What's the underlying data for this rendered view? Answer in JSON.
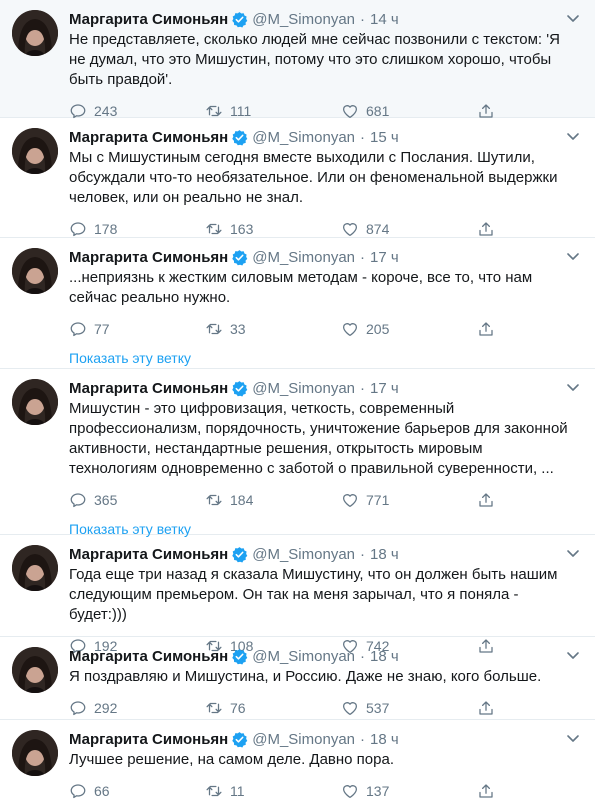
{
  "colors": {
    "accent": "#1da1f2",
    "muted": "#657786",
    "text": "#14171a",
    "highlight_bg": "#f5f8fa",
    "divider": "#e6ecf0"
  },
  "icons": {
    "reply": "reply-icon",
    "retweet": "retweet-icon",
    "like": "heart-icon",
    "share": "share-icon",
    "verified": "verified-badge-icon",
    "menu": "chevron-down-icon"
  },
  "tweets": [
    {
      "name": "Маргарита Симоньян",
      "handle": "@M_Simonyan",
      "sep": "·",
      "time": "14 ч",
      "text": "Не представляете, сколько людей мне сейчас позвонили с текстом: 'Я не думал, что это Мишустин, потому что это слишком хорошо, чтобы быть правдой'.",
      "replies": "243",
      "retweets": "111",
      "likes": "681"
    },
    {
      "name": "Маргарита Симоньян",
      "handle": "@M_Simonyan",
      "sep": "·",
      "time": "15 ч",
      "text": "Мы с Мишустиным сегодня вместе выходили с Послания. Шутили, обсуждали что-то необязательное. Или он феноменальной выдержки человек, или он реально не знал.",
      "replies": "178",
      "retweets": "163",
      "likes": "874"
    },
    {
      "name": "Маргарита Симоньян",
      "handle": "@M_Simonyan",
      "sep": "·",
      "time": "17 ч",
      "text": "...неприязнь к жестким силовым методам - короче, все то, что нам сейчас реально нужно.",
      "replies": "77",
      "retweets": "33",
      "likes": "205",
      "show_thread": "Показать эту ветку"
    },
    {
      "name": "Маргарита Симоньян",
      "handle": "@M_Simonyan",
      "sep": "·",
      "time": "17 ч",
      "text": "Мишустин - это цифровизация, четкость, современный профессионализм, порядочность, уничтожение барьеров для законной активности, нестандартные решения, открытость мировым технологиям одновременно с заботой о правильной суверенности, ...",
      "replies": "365",
      "retweets": "184",
      "likes": "771",
      "show_thread": "Показать эту ветку"
    },
    {
      "name": "Маргарита Симоньян",
      "handle": "@M_Simonyan",
      "sep": "·",
      "time": "18 ч",
      "text": "Года еще три назад я сказала Мишустину, что он должен быть нашим следующим премьером. Он так на меня зарычал, что я поняла - будет:)))",
      "replies": "192",
      "retweets": "108",
      "likes": "742"
    },
    {
      "name": "Маргарита Симоньян",
      "handle": "@M_Simonyan",
      "sep": "·",
      "time": "18 ч",
      "text": "Я поздравляю и Мишустина, и Россию. Даже не знаю, кого больше.",
      "replies": "292",
      "retweets": "76",
      "likes": "537"
    },
    {
      "name": "Маргарита Симоньян",
      "handle": "@M_Simonyan",
      "sep": "·",
      "time": "18 ч",
      "text": "Лучшее решение, на самом деле. Давно пора.",
      "replies": "66",
      "retweets": "11",
      "likes": "137"
    }
  ]
}
